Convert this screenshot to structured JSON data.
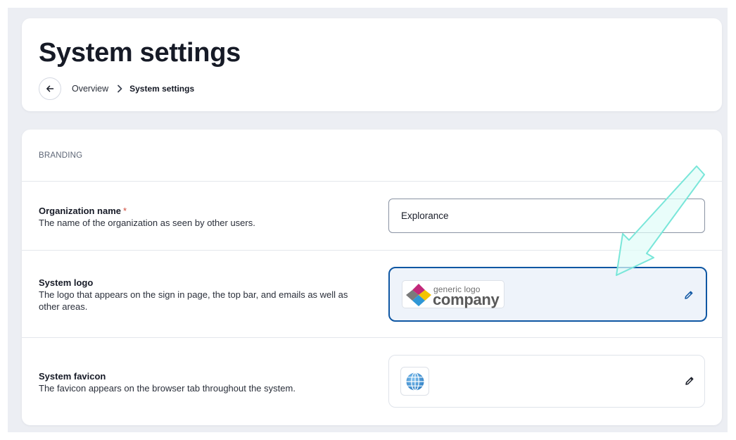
{
  "header": {
    "title": "System settings",
    "breadcrumb": {
      "overview": "Overview",
      "current": "System settings"
    }
  },
  "branding": {
    "section_label": "BRANDING",
    "org_name": {
      "label": "Organization name",
      "required_mark": "*",
      "description": "The name of the organization as seen by other users.",
      "value": "Explorance"
    },
    "system_logo": {
      "label": "System logo",
      "description": "The logo that appears on the sign in page, the top bar, and emails as well as other areas.",
      "logo_text_top": "generic logo",
      "logo_text_main": "company"
    },
    "system_favicon": {
      "label": "System favicon",
      "description": "The favicon appears on the browser tab throughout the system."
    }
  },
  "colors": {
    "focus_border": "#0f57a3",
    "focus_background": "#eef3fa",
    "annotation_arrow": "#7fe8dc",
    "required": "#d04a3a"
  },
  "icons": {
    "back": "arrow-left-icon",
    "separator": "chevron-right-icon",
    "edit": "pencil-icon",
    "favicon": "globe-icon"
  }
}
